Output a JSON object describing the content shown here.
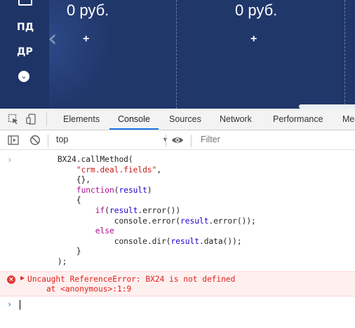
{
  "app": {
    "rail": {
      "items": [
        "ПД",
        "ДР"
      ],
      "more_icon": "chevron-down-icon"
    },
    "kanban": {
      "columns": [
        {
          "amount": "0 руб.",
          "add_label": "+"
        },
        {
          "amount": "0 руб.",
          "add_label": "+"
        }
      ],
      "prev_label": "‹"
    }
  },
  "devtools": {
    "tabs": [
      "Elements",
      "Console",
      "Sources",
      "Network",
      "Performance",
      "Me"
    ],
    "active_tab": "Console",
    "console_toolbar": {
      "context": "top",
      "filter_placeholder": "Filter"
    },
    "console": {
      "input_code": "BX24.callMethod(\n    \"crm.deal.fields\",\n    {},\n    function(result)\n    {\n        if(result.error())\n            console.error(result.error());\n        else\n            console.dir(result.data());\n    }\n);",
      "error": {
        "message": "Uncaught ReferenceError: BX24 is not defined",
        "location": "    at <anonymous>:1:9"
      }
    }
  },
  "colors": {
    "header_bg": "#20376a",
    "accent": "#1a73e8",
    "error": "#e0201a",
    "error_bg": "#fff0f0"
  }
}
